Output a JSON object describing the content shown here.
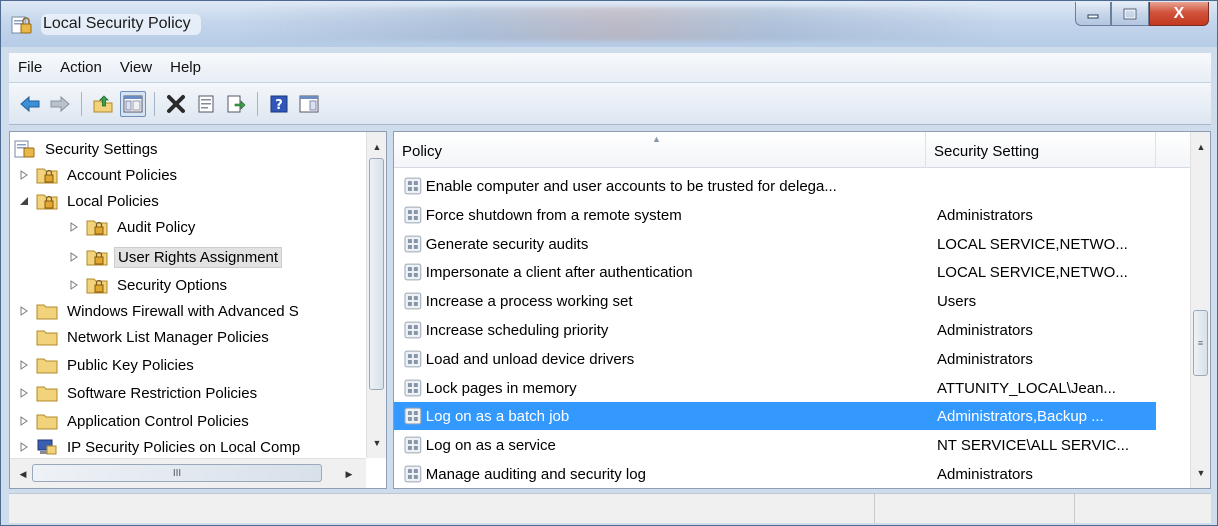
{
  "window": {
    "title": "Local Security Policy",
    "controls": {
      "minimize": "–",
      "maximize": "▢",
      "close": "X"
    }
  },
  "menu": [
    "File",
    "Action",
    "View",
    "Help"
  ],
  "toolbar": {
    "buttons": [
      "back-arrow-icon",
      "forward-arrow-icon",
      "up-folder-icon",
      "show-hide-tree-icon",
      "delete-icon",
      "properties-icon",
      "export-list-icon",
      "help-icon",
      "show-action-pane-icon"
    ]
  },
  "tree": {
    "root": "Security Settings",
    "items": [
      {
        "label": "Account Policies",
        "expander": "collapsed"
      },
      {
        "label": "Local Policies",
        "expander": "expanded"
      },
      {
        "label": "Audit Policy",
        "expander": "collapsed"
      },
      {
        "label": "User Rights Assignment",
        "expander": "collapsed",
        "selected": true
      },
      {
        "label": "Security Options",
        "expander": "collapsed"
      },
      {
        "label": "Windows Firewall with Advanced S",
        "expander": "collapsed"
      },
      {
        "label": "Network List Manager Policies",
        "expander": "none"
      },
      {
        "label": "Public Key Policies",
        "expander": "collapsed"
      },
      {
        "label": "Software Restriction Policies",
        "expander": "collapsed"
      },
      {
        "label": "Application Control Policies",
        "expander": "collapsed"
      },
      {
        "label": "IP Security Policies on Local Comp",
        "expander": "collapsed"
      }
    ],
    "hscroll_grip": "III"
  },
  "list": {
    "columns": [
      "Policy",
      "Security Setting"
    ],
    "rows": [
      {
        "policy": "Enable computer and user accounts to be trusted for delega...",
        "setting": ""
      },
      {
        "policy": "Force shutdown from a remote system",
        "setting": "Administrators"
      },
      {
        "policy": "Generate security audits",
        "setting": "LOCAL SERVICE,NETWO..."
      },
      {
        "policy": "Impersonate a client after authentication",
        "setting": "LOCAL SERVICE,NETWO..."
      },
      {
        "policy": "Increase a process working set",
        "setting": "Users"
      },
      {
        "policy": "Increase scheduling priority",
        "setting": "Administrators"
      },
      {
        "policy": "Load and unload device drivers",
        "setting": "Administrators"
      },
      {
        "policy": "Lock pages in memory",
        "setting": "ATTUNITY_LOCAL\\Jean..."
      },
      {
        "policy": "Log on as a batch job",
        "setting": "Administrators,Backup ...",
        "selected": true
      },
      {
        "policy": "Log on as a service",
        "setting": "NT SERVICE\\ALL SERVIC..."
      },
      {
        "policy": "Manage auditing and security log",
        "setting": "Administrators"
      }
    ]
  },
  "colors": {
    "selection": "#3399ff",
    "folder": "#f2d27a",
    "titlebar": "#c4d6ec"
  }
}
